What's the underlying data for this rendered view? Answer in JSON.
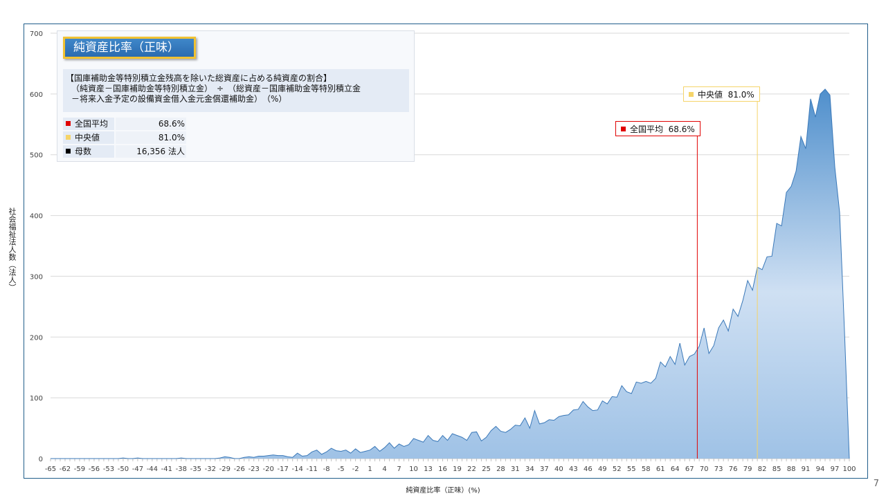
{
  "page_number": "7",
  "info_box": {
    "title": "純資産比率（正味）",
    "formula_line1": "【国庫補助金等特別積立金残高を除いた総資産に占める純資産の割合】",
    "formula_line2": "（純資産－国庫補助金等特別積立金）　÷　（総資産－国庫補助金等特別積立金",
    "formula_line3": "－将来入金予定の設備資金借入金元金償還補助金）　（%）",
    "stats": [
      {
        "label": "全国平均",
        "value": "68.6%",
        "color": "#e00000"
      },
      {
        "label": "中央値",
        "value": "81.0%",
        "color": "#f5d469"
      },
      {
        "label": "母数",
        "value": "16,356  法人",
        "color": "#000000"
      }
    ]
  },
  "callouts": {
    "average": {
      "label": "全国平均",
      "value": "68.6%",
      "color": "#e00000"
    },
    "median": {
      "label": "中央値",
      "value": "81.0%",
      "color": "#f5d469"
    }
  },
  "chart_data": {
    "type": "area",
    "title": "",
    "xlabel": "純資産比率（正味）(%)",
    "ylabel": "社会福祉法人数（法人）",
    "xlim": [
      -65,
      100
    ],
    "ylim": [
      0,
      700
    ],
    "yticks": [
      0,
      100,
      200,
      300,
      400,
      500,
      600,
      700
    ],
    "xticks": [
      -65,
      -62,
      -59,
      -56,
      -53,
      -50,
      -47,
      -44,
      -41,
      -38,
      -35,
      -32,
      -29,
      -26,
      -23,
      -20,
      -17,
      -14,
      -11,
      -8,
      -5,
      -2,
      1,
      4,
      7,
      10,
      13,
      16,
      19,
      22,
      25,
      28,
      31,
      34,
      37,
      40,
      43,
      46,
      49,
      52,
      55,
      58,
      61,
      64,
      67,
      70,
      73,
      76,
      79,
      82,
      85,
      88,
      91,
      94,
      97,
      100
    ],
    "grid": true,
    "reference_lines": [
      {
        "name": "全国平均",
        "x": 68.6,
        "color": "#e00000"
      },
      {
        "name": "中央値",
        "x": 81.0,
        "color": "#f5d469"
      }
    ],
    "x": [
      -65,
      -64,
      -63,
      -62,
      -61,
      -60,
      -59,
      -58,
      -57,
      -56,
      -55,
      -54,
      -53,
      -52,
      -51,
      -50,
      -49,
      -48,
      -47,
      -46,
      -45,
      -44,
      -43,
      -42,
      -41,
      -40,
      -39,
      -38,
      -37,
      -36,
      -35,
      -34,
      -33,
      -32,
      -31,
      -30,
      -29,
      -28,
      -27,
      -26,
      -25,
      -24,
      -23,
      -22,
      -21,
      -20,
      -19,
      -18,
      -17,
      -16,
      -15,
      -14,
      -13,
      -12,
      -11,
      -10,
      -9,
      -8,
      -7,
      -6,
      -5,
      -4,
      -3,
      -2,
      -1,
      0,
      1,
      2,
      3,
      4,
      5,
      6,
      7,
      8,
      9,
      10,
      11,
      12,
      13,
      14,
      15,
      16,
      17,
      18,
      19,
      20,
      21,
      22,
      23,
      24,
      25,
      26,
      27,
      28,
      29,
      30,
      31,
      32,
      33,
      34,
      35,
      36,
      37,
      38,
      39,
      40,
      41,
      42,
      43,
      44,
      45,
      46,
      47,
      48,
      49,
      50,
      51,
      52,
      53,
      54,
      55,
      56,
      57,
      58,
      59,
      60,
      61,
      62,
      63,
      64,
      65,
      66,
      67,
      68,
      69,
      70,
      71,
      72,
      73,
      74,
      75,
      76,
      77,
      78,
      79,
      80,
      81,
      82,
      83,
      84,
      85,
      86,
      87,
      88,
      89,
      90,
      91,
      92,
      93,
      94,
      95,
      96,
      97,
      98,
      99,
      100
    ],
    "values": [
      0,
      0,
      0,
      0,
      0,
      0,
      0,
      0,
      0,
      0,
      0,
      0,
      0,
      0,
      0,
      1,
      0,
      0,
      1,
      0,
      0,
      0,
      0,
      0,
      0,
      0,
      0,
      1,
      0,
      0,
      0,
      0,
      0,
      0,
      0,
      1,
      3,
      2,
      0,
      0,
      2,
      3,
      2,
      4,
      4,
      5,
      6,
      5,
      5,
      3,
      2,
      9,
      4,
      5,
      11,
      14,
      7,
      11,
      17,
      13,
      12,
      14,
      9,
      16,
      10,
      12,
      14,
      20,
      12,
      18,
      26,
      17,
      24,
      20,
      23,
      33,
      30,
      27,
      38,
      30,
      28,
      38,
      30,
      41,
      38,
      35,
      30,
      43,
      44,
      29,
      35,
      46,
      53,
      45,
      43,
      48,
      55,
      54,
      67,
      50,
      79,
      57,
      59,
      64,
      63,
      69,
      71,
      72,
      80,
      81,
      94,
      85,
      79,
      80,
      95,
      90,
      102,
      101,
      120,
      110,
      107,
      126,
      124,
      127,
      124,
      132,
      159,
      151,
      168,
      155,
      190,
      154,
      168,
      172,
      185,
      215,
      173,
      186,
      215,
      228,
      210,
      246,
      234,
      260,
      293,
      277,
      315,
      311,
      332,
      333,
      387,
      383,
      438,
      448,
      473,
      530,
      510,
      592,
      562,
      600,
      608,
      598,
      480,
      405,
      210,
      0
    ]
  }
}
